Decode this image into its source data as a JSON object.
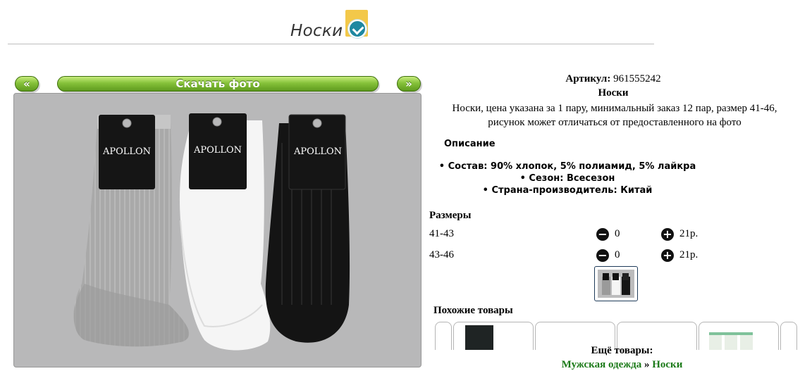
{
  "page": {
    "title": "Носки"
  },
  "gallery": {
    "prev_label": "«",
    "download_label": "Скачать фото",
    "next_label": "»",
    "brand_labels": [
      "APOLLON",
      "APOLLON",
      "APOLLON"
    ]
  },
  "product": {
    "article_label": "Артикул:",
    "article_value": "961555242",
    "name": "Носки",
    "short_description": "Носки, цена указана за 1 пару, минимальный заказ 12 пар, размер 41-46, рисунок может отличаться от предоставленного на фото",
    "description_heading": "Описание",
    "features": [
      "Состав: 90% хлопок, 5% полиамид, 5% лайкра",
      "Сезон: Всесезон",
      "Страна-производитель: Китай"
    ]
  },
  "sizes": {
    "heading": "Размеры",
    "minus_icon": "−",
    "plus_icon": "+",
    "rows": [
      {
        "size": "41-43",
        "qty": "0",
        "price": "21р."
      },
      {
        "size": "43-46",
        "qty": "0",
        "price": "21р."
      }
    ]
  },
  "similar": {
    "heading": "Похожие товары"
  },
  "more": {
    "heading": "Ещё товары:",
    "breadcrumb": [
      "Мужская одежда",
      "Носки"
    ],
    "separator": " » "
  },
  "colors": {
    "accent_green": "#86c23a",
    "badge_yellow": "#f3c84a",
    "badge_teal": "#1e88a0",
    "link_green": "#1b7a18"
  }
}
